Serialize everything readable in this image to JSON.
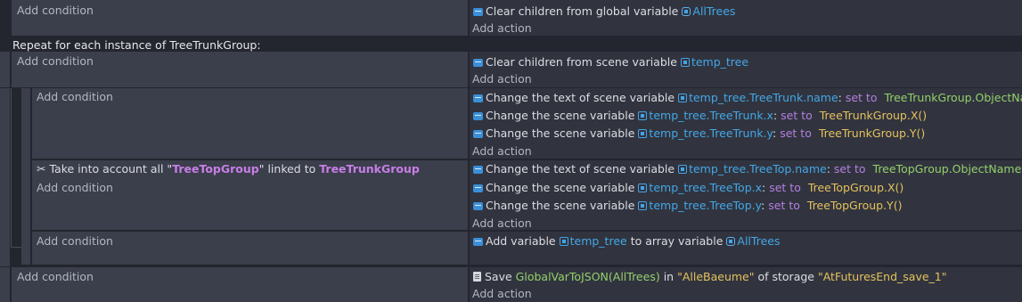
{
  "common": {
    "add_condition": "Add condition",
    "add_action": "Add action"
  },
  "event1": {
    "action": {
      "prefix": "Clear children from global variable",
      "variable": "AllTrees"
    }
  },
  "repeat": {
    "header": "Repeat for each instance of TreeTrunkGroup:",
    "action": {
      "prefix": "Clear children from scene variable",
      "variable": "temp_tree"
    }
  },
  "sub1": {
    "actions": [
      {
        "prefix": "Change the text of scene variable",
        "variable": "temp_tree.TreeTrunk.name",
        "colon": ":",
        "op": "set to",
        "expr": "TreeTrunkGroup.ObjectName()"
      },
      {
        "prefix": "Change the scene variable",
        "variable": "temp_tree.TreeTrunk.x",
        "colon": ":",
        "op": "set to",
        "expr": "TreeTrunkGroup.X()"
      },
      {
        "prefix": "Change the scene variable",
        "variable": "temp_tree.TreeTrunk.y",
        "colon": ":",
        "op": "set to",
        "expr": "TreeTrunkGroup.Y()"
      }
    ]
  },
  "sub2": {
    "link": {
      "prefix": "Take into account all \"",
      "object": "TreeTopGroup",
      "middle": "\" linked to",
      "target": "TreeTrunkGroup"
    },
    "actions": [
      {
        "prefix": "Change the text of scene variable",
        "variable": "temp_tree.TreeTop.name",
        "colon": ":",
        "op": "set to",
        "expr": "TreeTopGroup.ObjectName()"
      },
      {
        "prefix": "Change the scene variable",
        "variable": "temp_tree.TreeTop.x",
        "colon": ":",
        "op": "set to",
        "expr": "TreeTopGroup.X()"
      },
      {
        "prefix": "Change the scene variable",
        "variable": "temp_tree.TreeTop.y",
        "colon": ":",
        "op": "set to",
        "expr": "TreeTopGroup.Y()"
      }
    ]
  },
  "sub3": {
    "action": {
      "prefix": "Add variable",
      "variable": "temp_tree",
      "middle": "to array variable",
      "target": "AllTrees"
    }
  },
  "event_last": {
    "action": {
      "prefix": "Save",
      "func": "GlobalVarToJSON(AllTrees)",
      "in": "in",
      "key": "\"AlleBaeume\"",
      "of": "of storage",
      "storage": "\"AtFuturesEnd_save_1\""
    }
  },
  "icons": {
    "action_icon": "variable-action-icon",
    "scene_var_icon": "scene-variable-icon",
    "global_var_icon": "global-variable-icon",
    "link_icon": "scissors-icon",
    "storage_icon": "storage-document-icon"
  },
  "colors": {
    "background": "#23262e",
    "condition_bg": "#3b3e4b",
    "action_bg": "#31343f",
    "variable": "#43a7e6",
    "keyword": "#b67fe0",
    "expression": "#e5c15c",
    "function": "#94d06a"
  }
}
